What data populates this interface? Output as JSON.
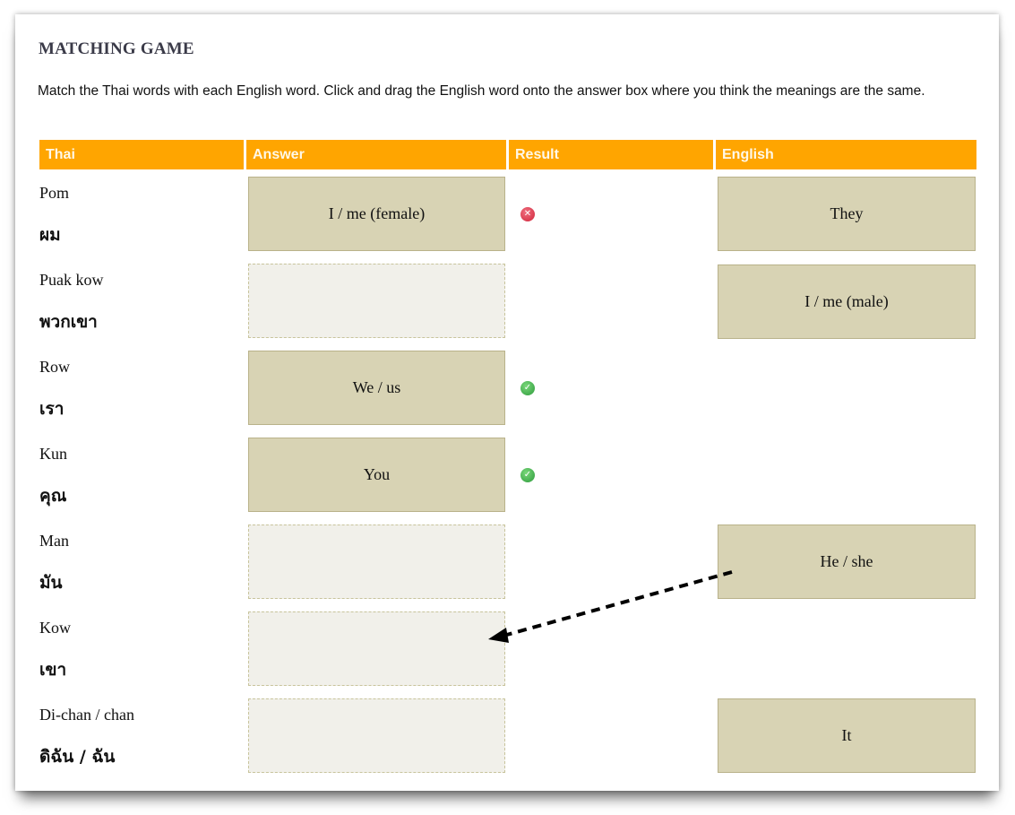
{
  "title": "MATCHING GAME",
  "instructions": "Match the Thai words with each English word. Click and drag the English word onto the answer box where you think the meanings are the same.",
  "headers": {
    "thai": "Thai",
    "answer": "Answer",
    "result": "Result",
    "english": "English"
  },
  "colors": {
    "header_bg": "#ffa500",
    "tile_bg": "#d8d3b4",
    "empty_bg": "#f1f0ea",
    "wrong": "#d0243a",
    "right": "#2d9a3c"
  },
  "rows": [
    {
      "roman": "Pom",
      "thai": "ผม",
      "answer": "I / me (female)",
      "result": "wrong"
    },
    {
      "roman": "Puak kow",
      "thai": "พวกเขา",
      "answer": "",
      "result": ""
    },
    {
      "roman": "Row",
      "thai": "เรา",
      "answer": "We / us",
      "result": "right"
    },
    {
      "roman": "Kun",
      "thai": "คุณ",
      "answer": "You",
      "result": "right"
    },
    {
      "roman": "Man",
      "thai": "มัน",
      "answer": "",
      "result": ""
    },
    {
      "roman": "Kow",
      "thai": "เขา",
      "answer": "",
      "result": ""
    },
    {
      "roman": "Di-chan / chan",
      "thai": "ดิฉัน / ฉัน",
      "answer": "",
      "result": ""
    }
  ],
  "english_tiles": [
    {
      "label": "They",
      "row": 0
    },
    {
      "label": "I / me (male)",
      "row": 1
    },
    {
      "label": "He / she",
      "row": 4
    },
    {
      "label": "It",
      "row": 6
    }
  ],
  "icons": {
    "wrong": "x-circle-icon",
    "right": "check-circle-icon"
  },
  "glyphs": {
    "wrong": "✕",
    "right": "✓"
  }
}
